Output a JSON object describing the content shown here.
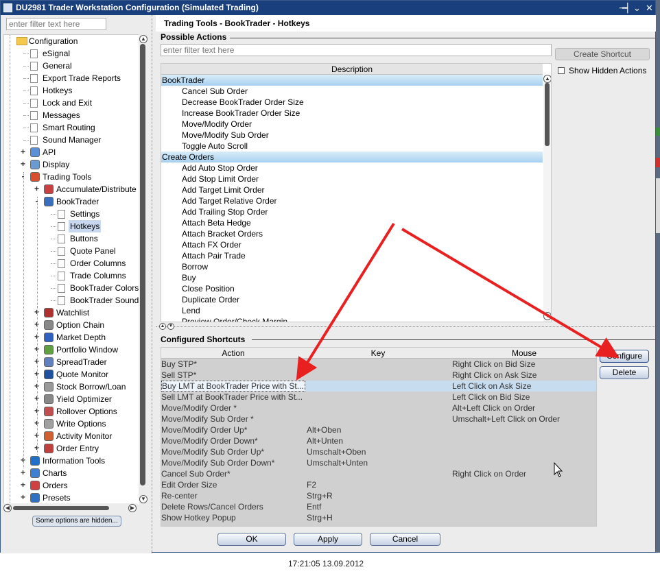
{
  "window": {
    "title": "DU2981 Trader Workstation Configuration (Simulated Trading)",
    "controls": [
      "╼┥",
      "⌄",
      "✕"
    ]
  },
  "left": {
    "filter_placeholder": "enter filter text here",
    "tree": [
      {
        "label": "Configuration",
        "level": 0,
        "icon": "folder-icon"
      },
      {
        "label": "eSignal",
        "level": 1,
        "icon": "document-icon"
      },
      {
        "label": "General",
        "level": 1,
        "icon": "document-icon"
      },
      {
        "label": "Export Trade Reports",
        "level": 1,
        "icon": "document-icon"
      },
      {
        "label": "Hotkeys",
        "level": 1,
        "icon": "document-icon"
      },
      {
        "label": "Lock and Exit",
        "level": 1,
        "icon": "document-icon"
      },
      {
        "label": "Messages",
        "level": 1,
        "icon": "document-icon"
      },
      {
        "label": "Smart Routing",
        "level": 1,
        "icon": "document-icon"
      },
      {
        "label": "Sound Manager",
        "level": 1,
        "icon": "document-icon"
      },
      {
        "label": "API",
        "level": 1,
        "icon": "api-icon",
        "expand": "+"
      },
      {
        "label": "Display",
        "level": 1,
        "icon": "display-icon",
        "expand": "+"
      },
      {
        "label": "Trading Tools",
        "level": 1,
        "icon": "trading-tools-icon",
        "expand": "-"
      },
      {
        "label": "Accumulate/Distribute",
        "level": 2,
        "icon": "accumulate-icon",
        "expand": "+"
      },
      {
        "label": "BookTrader",
        "level": 2,
        "icon": "booktrader-icon",
        "expand": "-"
      },
      {
        "label": "Settings",
        "level": 3,
        "icon": "document-icon"
      },
      {
        "label": "Hotkeys",
        "level": 3,
        "icon": "document-icon",
        "selected": true
      },
      {
        "label": "Buttons",
        "level": 3,
        "icon": "document-icon"
      },
      {
        "label": "Quote Panel",
        "level": 3,
        "icon": "document-icon"
      },
      {
        "label": "Order Columns",
        "level": 3,
        "icon": "document-icon"
      },
      {
        "label": "Trade Columns",
        "level": 3,
        "icon": "document-icon"
      },
      {
        "label": "BookTrader Colors",
        "level": 3,
        "icon": "document-icon"
      },
      {
        "label": "BookTrader Sound M",
        "level": 3,
        "icon": "document-icon"
      },
      {
        "label": "Watchlist",
        "level": 2,
        "icon": "watchlist-icon",
        "expand": "+"
      },
      {
        "label": "Option Chain",
        "level": 2,
        "icon": "option-chain-icon",
        "expand": "+"
      },
      {
        "label": "Market Depth",
        "level": 2,
        "icon": "market-depth-icon",
        "expand": "+"
      },
      {
        "label": "Portfolio Window",
        "level": 2,
        "icon": "portfolio-icon",
        "expand": "+"
      },
      {
        "label": "SpreadTrader",
        "level": 2,
        "icon": "spreadtrader-icon",
        "expand": "+"
      },
      {
        "label": "Quote Monitor",
        "level": 2,
        "icon": "quote-monitor-icon",
        "expand": "+"
      },
      {
        "label": "Stock Borrow/Loan",
        "level": 2,
        "icon": "stock-borrow-icon",
        "expand": "+"
      },
      {
        "label": "Yield Optimizer",
        "level": 2,
        "icon": "yield-optimizer-icon",
        "expand": "+"
      },
      {
        "label": "Rollover Options",
        "level": 2,
        "icon": "rollover-icon",
        "expand": "+"
      },
      {
        "label": "Write Options",
        "level": 2,
        "icon": "write-options-icon",
        "expand": "+"
      },
      {
        "label": "Activity Monitor",
        "level": 2,
        "icon": "activity-monitor-icon",
        "expand": "+"
      },
      {
        "label": "Order Entry",
        "level": 2,
        "icon": "order-entry-icon",
        "expand": "+"
      },
      {
        "label": "Information Tools",
        "level": 1,
        "icon": "info-icon",
        "expand": "+"
      },
      {
        "label": "Charts",
        "level": 1,
        "icon": "charts-icon",
        "expand": "+"
      },
      {
        "label": "Orders",
        "level": 1,
        "icon": "orders-icon",
        "expand": "+"
      },
      {
        "label": "Presets",
        "level": 1,
        "icon": "presets-icon",
        "expand": "+"
      }
    ],
    "hidden_options_button": "Some options are hidden..."
  },
  "right": {
    "header": "Trading Tools - BookTrader - Hotkeys",
    "possible_actions_title": "Possible Actions",
    "filter_placeholder": "enter filter text here",
    "create_shortcut_button": "Create Shortcut",
    "show_hidden_actions_label": "Show Hidden Actions",
    "show_hidden_checked": false,
    "actions_column_header": "Description",
    "actions_rows": [
      {
        "type": "group",
        "label": "BookTrader"
      },
      {
        "type": "item",
        "label": "Cancel Sub Order"
      },
      {
        "type": "item",
        "label": "Decrease BookTrader Order Size"
      },
      {
        "type": "item",
        "label": "Increase BookTrader Order Size"
      },
      {
        "type": "item",
        "label": "Move/Modify Order"
      },
      {
        "type": "item",
        "label": "Move/Modify Sub Order"
      },
      {
        "type": "item",
        "label": "Toggle Auto Scroll"
      },
      {
        "type": "group",
        "label": "Create Orders"
      },
      {
        "type": "item",
        "label": "Add Auto Stop Order"
      },
      {
        "type": "item",
        "label": "Add Stop Limit Order"
      },
      {
        "type": "item",
        "label": "Add Target Limit Order"
      },
      {
        "type": "item",
        "label": "Add Target Relative Order"
      },
      {
        "type": "item",
        "label": "Add Trailing Stop Order"
      },
      {
        "type": "item",
        "label": "Attach Beta Hedge"
      },
      {
        "type": "item",
        "label": "Attach Bracket Orders"
      },
      {
        "type": "item",
        "label": "Attach FX Order"
      },
      {
        "type": "item",
        "label": "Attach Pair Trade"
      },
      {
        "type": "item",
        "label": "Borrow"
      },
      {
        "type": "item",
        "label": "Buy"
      },
      {
        "type": "item",
        "label": "Close Position"
      },
      {
        "type": "item",
        "label": "Duplicate Order"
      },
      {
        "type": "item",
        "label": "Lend"
      },
      {
        "type": "item",
        "label": "Preview Order/Check Margin"
      }
    ],
    "configured_shortcuts_title": "Configured Shortcuts",
    "shortcut_columns": [
      "Action",
      "Key",
      "Mouse"
    ],
    "shortcuts": [
      {
        "action": "Buy STP*",
        "key": "",
        "mouse": "Right Click on Bid Size"
      },
      {
        "action": "Sell STP*",
        "key": "",
        "mouse": "Right Click on Ask Size"
      },
      {
        "action": "Buy LMT at BookTrader Price with St...",
        "key": "",
        "mouse": "Left Click on Ask Size",
        "selected": true
      },
      {
        "action": "Sell LMT at BookTrader Price with St...",
        "key": "",
        "mouse": "Left Click on Bid Size"
      },
      {
        "action": "Move/Modify Order *",
        "key": "",
        "mouse": "Alt+Left Click on Order"
      },
      {
        "action": "Move/Modify Sub Order *",
        "key": "",
        "mouse": "Umschalt+Left Click on Order"
      },
      {
        "action": "Move/Modify Order Up*",
        "key": "Alt+Oben",
        "mouse": ""
      },
      {
        "action": "Move/Modify Order Down*",
        "key": "Alt+Unten",
        "mouse": ""
      },
      {
        "action": "Move/Modify Sub Order Up*",
        "key": "Umschalt+Oben",
        "mouse": ""
      },
      {
        "action": "Move/Modify Sub Order Down*",
        "key": "Umschalt+Unten",
        "mouse": ""
      },
      {
        "action": "Cancel Sub Order*",
        "key": "",
        "mouse": "Right Click on Order"
      },
      {
        "action": "Edit Order Size",
        "key": "F2",
        "mouse": ""
      },
      {
        "action": "Re-center",
        "key": "Strg+R",
        "mouse": ""
      },
      {
        "action": "Delete Rows/Cancel Orders",
        "key": "Entf",
        "mouse": ""
      },
      {
        "action": "Show Hotkey Popup",
        "key": "Strg+H",
        "mouse": ""
      }
    ],
    "configure_button": "Configure",
    "delete_button": "Delete"
  },
  "footer": {
    "ok": "OK",
    "apply": "Apply",
    "cancel": "Cancel"
  },
  "timestamp": "17:21:05 13.09.2012",
  "colors": {
    "titlebar": "#1a3f7d",
    "group_row": "#a8d0f0",
    "annotation_arrow": "#e82020",
    "selection": "#c8dcf0"
  }
}
